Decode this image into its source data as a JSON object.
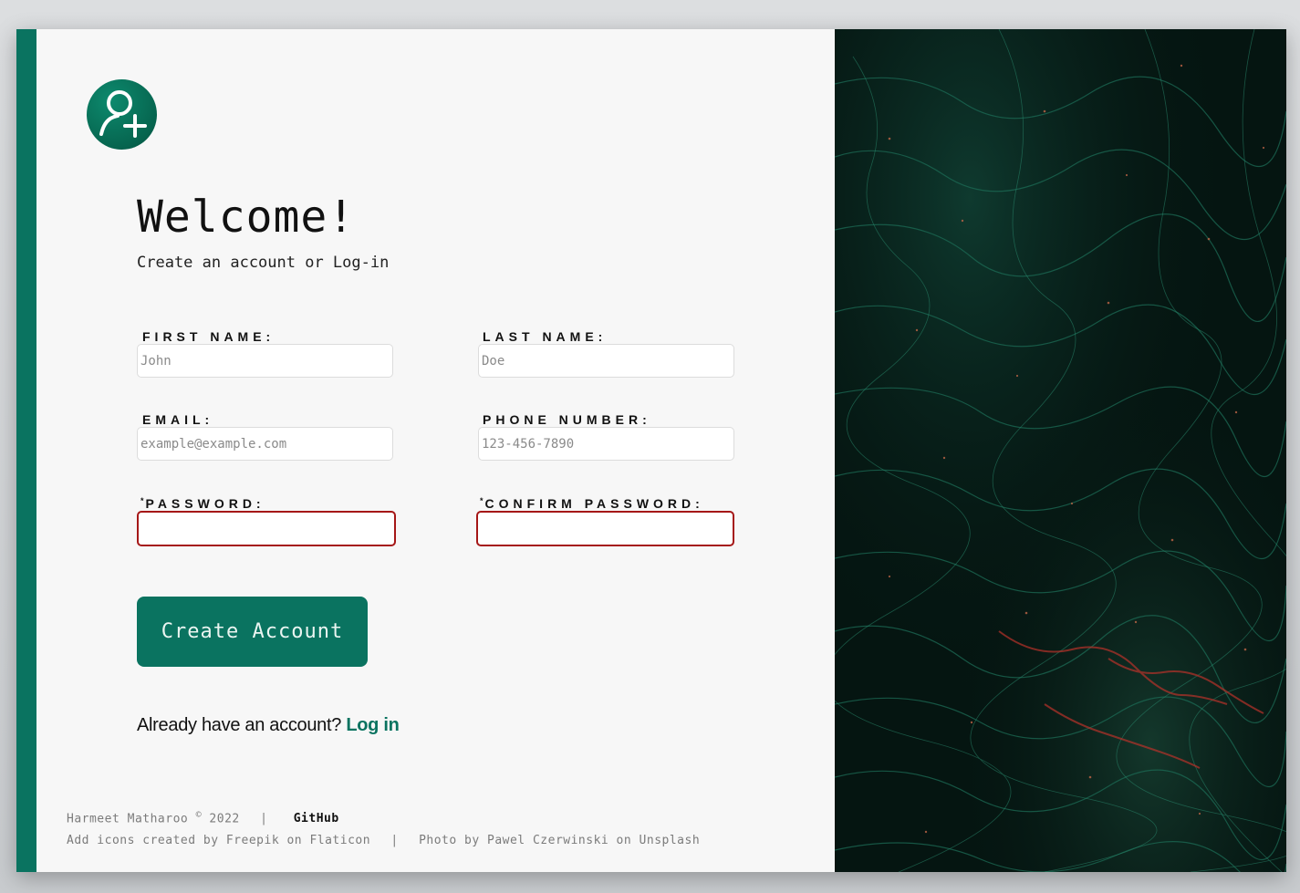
{
  "header": {
    "title": "Welcome!",
    "subtitle": "Create an account or Log-in",
    "logo_icon": "add-user-icon"
  },
  "form": {
    "first_name": {
      "label": "FIRST NAME:",
      "placeholder": "John",
      "value": ""
    },
    "last_name": {
      "label": "LAST NAME:",
      "placeholder": "Doe",
      "value": ""
    },
    "email": {
      "label": "EMAIL:",
      "placeholder": "example@example.com",
      "value": ""
    },
    "phone": {
      "label": "PHONE NUMBER:",
      "placeholder": "123-456-7890",
      "value": ""
    },
    "password": {
      "required_mark": "*",
      "label": "PASSWORD:",
      "value": ""
    },
    "confirm_password": {
      "required_mark": "*",
      "label": "CONFIRM PASSWORD:",
      "value": ""
    },
    "submit_label": "Create Account"
  },
  "login_prompt": {
    "text": "Already have an account?",
    "link_label": "Log in"
  },
  "footer": {
    "author": "Harmeet Matharoo",
    "copyright_symbol": "©",
    "year": "2022",
    "separator": "|",
    "github_label": "GitHub",
    "icon_credit": "Add icons created by Freepik on Flaticon",
    "photo_credit": "Photo by Pawel Czerwinski on Unsplash"
  },
  "colors": {
    "accent": "#0a7360",
    "invalid_border": "#a51717",
    "card_bg": "#f7f7f7",
    "photo_base": "#041410"
  }
}
